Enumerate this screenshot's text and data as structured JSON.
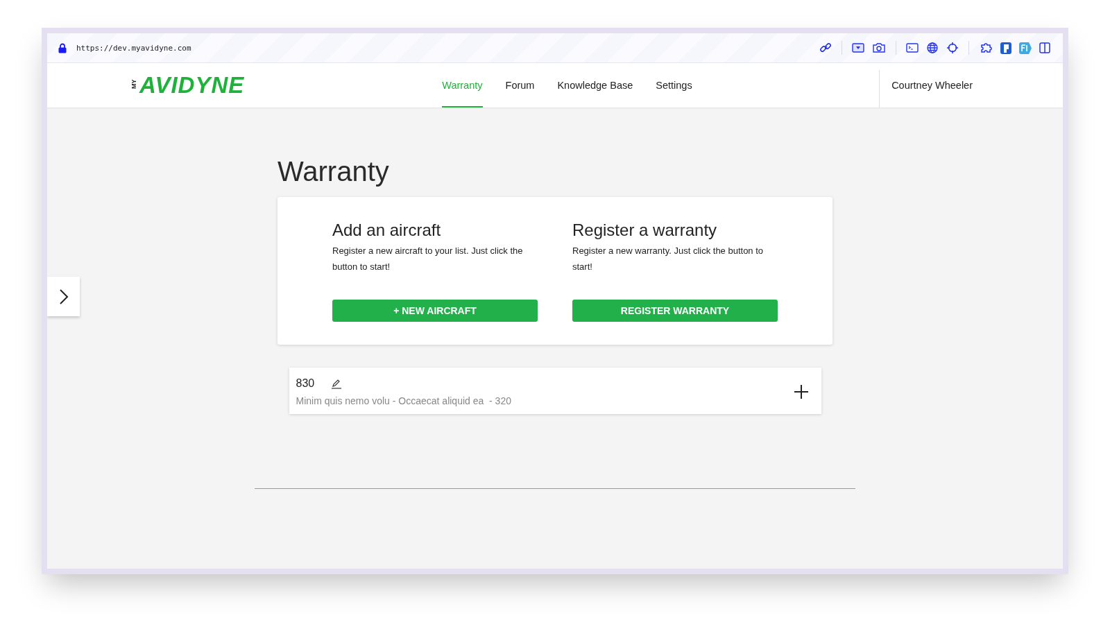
{
  "browser": {
    "url": "https://dev.myavidyne.com"
  },
  "header": {
    "logo": {
      "prefix": "MY",
      "name": "AVIDYNE"
    },
    "nav": [
      {
        "label": "Warranty",
        "selected": true
      },
      {
        "label": "Forum",
        "selected": false
      },
      {
        "label": "Knowledge Base",
        "selected": false
      },
      {
        "label": "Settings",
        "selected": false
      }
    ],
    "user": "Courtney Wheeler"
  },
  "page": {
    "title": "Warranty"
  },
  "actions": [
    {
      "title": "Add an aircraft",
      "description": "Register a new aircraft to your list. Just click the button to start!",
      "button": "+ NEW AIRCRAFT"
    },
    {
      "title": "Register a warranty",
      "description": "Register a new warranty. Just click the button to start!",
      "button": "REGISTER WARRANTY"
    }
  ],
  "aircraft": [
    {
      "name": "830",
      "details": "Minim quis nemo volu - Occaecat aliquid ea  - 320"
    }
  ]
}
